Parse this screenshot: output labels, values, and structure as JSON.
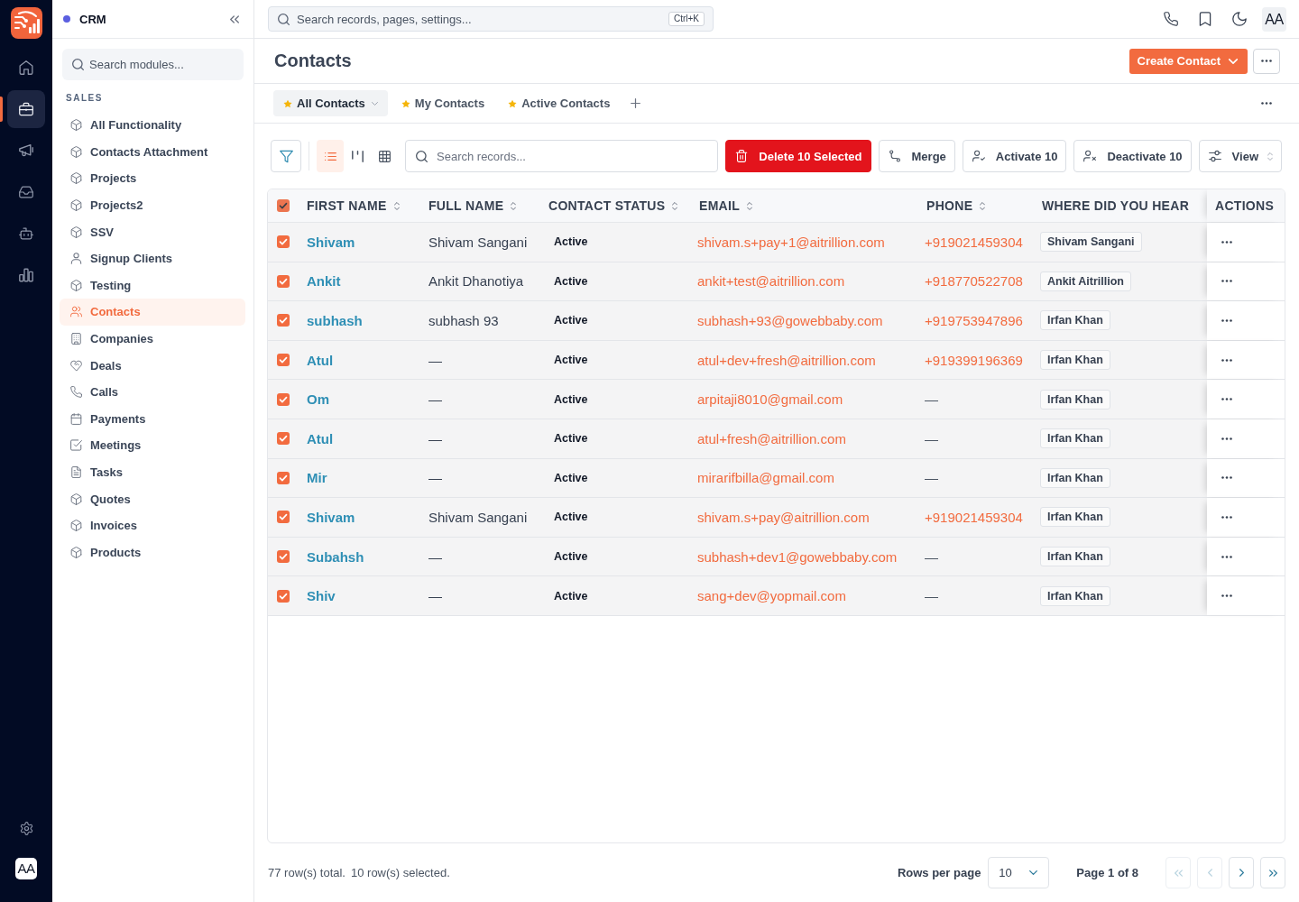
{
  "rail": {
    "items": [
      {
        "selected": false
      },
      {
        "selected": true
      },
      {
        "selected": false
      },
      {
        "selected": false
      },
      {
        "selected": false
      },
      {
        "selected": false
      }
    ],
    "avatar": "AA"
  },
  "sidebar": {
    "title": "CRM",
    "search": {
      "placeholder": "Search modules..."
    },
    "section": "SALES",
    "items": [
      {
        "label": "All Functionality",
        "selected": false
      },
      {
        "label": "Contacts Attachment",
        "selected": false
      },
      {
        "label": "Projects",
        "selected": false
      },
      {
        "label": "Projects2",
        "selected": false
      },
      {
        "label": "SSV",
        "selected": false
      },
      {
        "label": "Signup Clients",
        "selected": false
      },
      {
        "label": "Testing",
        "selected": false
      },
      {
        "label": "Contacts",
        "selected": true
      },
      {
        "label": "Companies",
        "selected": false
      },
      {
        "label": "Deals",
        "selected": false
      },
      {
        "label": "Calls",
        "selected": false
      },
      {
        "label": "Payments",
        "selected": false
      },
      {
        "label": "Meetings",
        "selected": false
      },
      {
        "label": "Tasks",
        "selected": false
      },
      {
        "label": "Quotes",
        "selected": false
      },
      {
        "label": "Invoices",
        "selected": false
      },
      {
        "label": "Products",
        "selected": false
      }
    ]
  },
  "topbar": {
    "search": {
      "placeholder": "Search records, pages, settings...",
      "shortcut": "Ctrl+K"
    },
    "avatar": "AA"
  },
  "header": {
    "title": "Contacts",
    "create_button": "Create Contact"
  },
  "view_tabs": [
    {
      "label": "All Contacts",
      "selected": true
    },
    {
      "label": "My Contacts",
      "selected": false
    },
    {
      "label": "Active Contacts",
      "selected": false
    }
  ],
  "toolbar": {
    "view_modes": [
      {
        "selected": true
      },
      {
        "selected": false
      },
      {
        "selected": false
      }
    ],
    "search": {
      "placeholder": "Search records..."
    },
    "actions": [
      {
        "kind": "delete",
        "label": "Delete 10 Selected"
      },
      {
        "kind": "merge",
        "label": "Merge"
      },
      {
        "kind": "activate",
        "label": "Activate 10"
      },
      {
        "kind": "deactivate",
        "label": "Deactivate 10"
      },
      {
        "kind": "view",
        "label": "View"
      }
    ]
  },
  "table": {
    "all_checked": true,
    "columns": [
      {
        "label": "FIRST NAME",
        "sortable": true
      },
      {
        "label": "FULL NAME",
        "sortable": true
      },
      {
        "label": "CONTACT STATUS",
        "sortable": true
      },
      {
        "label": "EMAIL",
        "sortable": true
      },
      {
        "label": "PHONE",
        "sortable": true
      },
      {
        "label": "WHERE DID YOU HEAR",
        "sortable": false
      },
      {
        "label": "ACTIONS",
        "sortable": false
      }
    ],
    "rows": [
      {
        "checked": true,
        "first_name": "Shivam",
        "full_name": "Shivam Sangani",
        "status": "Active",
        "email": "shivam.s+pay+1@aitrillion.com",
        "phone": {
          "text": "+919021459304",
          "link": true
        },
        "where_did_you_hear": "Shivam Sangani"
      },
      {
        "checked": true,
        "first_name": "Ankit",
        "full_name": "Ankit Dhanotiya",
        "status": "Active",
        "email": "ankit+test@aitrillion.com",
        "phone": {
          "text": "+918770522708",
          "link": true
        },
        "where_did_you_hear": "Ankit Aitrillion"
      },
      {
        "checked": true,
        "first_name": "subhash",
        "full_name": "subhash 93",
        "status": "Active",
        "email": "subhash+93@gowebbaby.com",
        "phone": {
          "text": "+919753947896",
          "link": true
        },
        "where_did_you_hear": "Irfan Khan"
      },
      {
        "checked": true,
        "first_name": "Atul",
        "full_name": "—",
        "status": "Active",
        "email": "atul+dev+fresh@aitrillion.com",
        "phone": {
          "text": "+919399196369",
          "link": true
        },
        "where_did_you_hear": "Irfan Khan"
      },
      {
        "checked": true,
        "first_name": "Om",
        "full_name": "—",
        "status": "Active",
        "email": "arpitaji8010@gmail.com",
        "phone": {
          "text": "—",
          "link": false
        },
        "where_did_you_hear": "Irfan Khan"
      },
      {
        "checked": true,
        "first_name": "Atul",
        "full_name": "—",
        "status": "Active",
        "email": "atul+fresh@aitrillion.com",
        "phone": {
          "text": "—",
          "link": false
        },
        "where_did_you_hear": "Irfan Khan"
      },
      {
        "checked": true,
        "first_name": "Mir",
        "full_name": "—",
        "status": "Active",
        "email": "mirarifbilla@gmail.com",
        "phone": {
          "text": "—",
          "link": false
        },
        "where_did_you_hear": "Irfan Khan"
      },
      {
        "checked": true,
        "first_name": "Shivam",
        "full_name": "Shivam Sangani",
        "status": "Active",
        "email": "shivam.s+pay@aitrillion.com",
        "phone": {
          "text": "+919021459304",
          "link": true
        },
        "where_did_you_hear": "Irfan Khan"
      },
      {
        "checked": true,
        "first_name": "Subahsh",
        "full_name": "—",
        "status": "Active",
        "email": "subhash+dev1@gowebbaby.com",
        "phone": {
          "text": "—",
          "link": false
        },
        "where_did_you_hear": "Irfan Khan"
      },
      {
        "checked": true,
        "first_name": "Shiv",
        "full_name": "—",
        "status": "Active",
        "email": "sang+dev@yopmail.com",
        "phone": {
          "text": "—",
          "link": false
        },
        "where_did_you_hear": "Irfan Khan"
      }
    ]
  },
  "footer": {
    "total": "77 row(s) total.",
    "selected": "10 row(s) selected.",
    "rows_per_page_label": "Rows per page",
    "rows_per_page": "10",
    "page": "Page 1 of 8",
    "pager": [
      {
        "disabled": true
      },
      {
        "disabled": true
      },
      {
        "disabled": false
      },
      {
        "disabled": false
      }
    ]
  }
}
